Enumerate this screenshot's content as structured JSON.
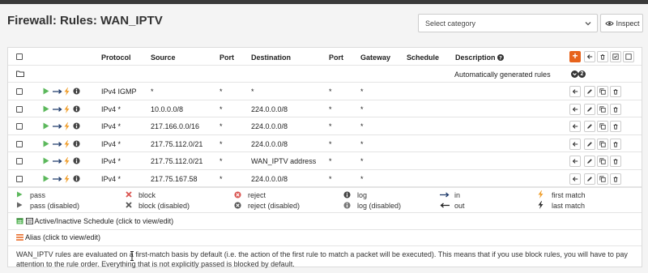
{
  "page": {
    "title": "Firewall: Rules: WAN_IPTV",
    "category_placeholder": "Select category",
    "inspect_label": "Inspect"
  },
  "table": {
    "headers": {
      "protocol": "Protocol",
      "source": "Source",
      "port": "Port",
      "destination": "Destination",
      "dest_port": "Port",
      "gateway": "Gateway",
      "schedule": "Schedule",
      "description": "Description"
    },
    "auto_row": {
      "label": "Automatically generated rules",
      "count": "2"
    },
    "rules": [
      {
        "protocol": "IPv4 IGMP",
        "source": "*",
        "port": "*",
        "destination": "*",
        "dest_port": "*",
        "gateway": "*",
        "schedule": ""
      },
      {
        "protocol": "IPv4 *",
        "source": "10.0.0.0/8",
        "port": "*",
        "destination": "224.0.0.0/8",
        "dest_port": "*",
        "gateway": "*",
        "schedule": ""
      },
      {
        "protocol": "IPv4 *",
        "source": "217.166.0.0/16",
        "port": "*",
        "destination": "224.0.0.0/8",
        "dest_port": "*",
        "gateway": "*",
        "schedule": ""
      },
      {
        "protocol": "IPv4 *",
        "source": "217.75.112.0/21",
        "port": "*",
        "destination": "224.0.0.0/8",
        "dest_port": "*",
        "gateway": "*",
        "schedule": ""
      },
      {
        "protocol": "IPv4 *",
        "source": "217.75.112.0/21",
        "port": "*",
        "destination": "WAN_IPTV address",
        "dest_port": "*",
        "gateway": "*",
        "schedule": ""
      },
      {
        "protocol": "IPv4 *",
        "source": "217.75.167.58",
        "port": "*",
        "destination": "224.0.0.0/8",
        "dest_port": "*",
        "gateway": "*",
        "schedule": ""
      }
    ]
  },
  "legend": {
    "pass": "pass",
    "pass_disabled": "pass (disabled)",
    "block": "block",
    "block_disabled": "block (disabled)",
    "reject": "reject",
    "reject_disabled": "reject (disabled)",
    "log": "log",
    "log_disabled": "log (disabled)",
    "in": "in",
    "out": "out",
    "first_match": "first match",
    "last_match": "last match",
    "schedule": "Active/Inactive Schedule (click to view/edit)",
    "alias": "Alias (click to view/edit)"
  },
  "footer_text": "WAN_IPTV rules are evaluated on a first-match basis by default (i.e. the action of the first rule to match a packet will be executed). This means that if you use block rules, you will have to pay attention to the rule order. Everything that is not explicitly passed is blocked by default.",
  "colors": {
    "pass": "#5cb85c",
    "arrow": "#1f3b6b",
    "bolt": "#f0a030",
    "info": "#444444",
    "accent": "#e7631c",
    "block": "#d9534f"
  }
}
